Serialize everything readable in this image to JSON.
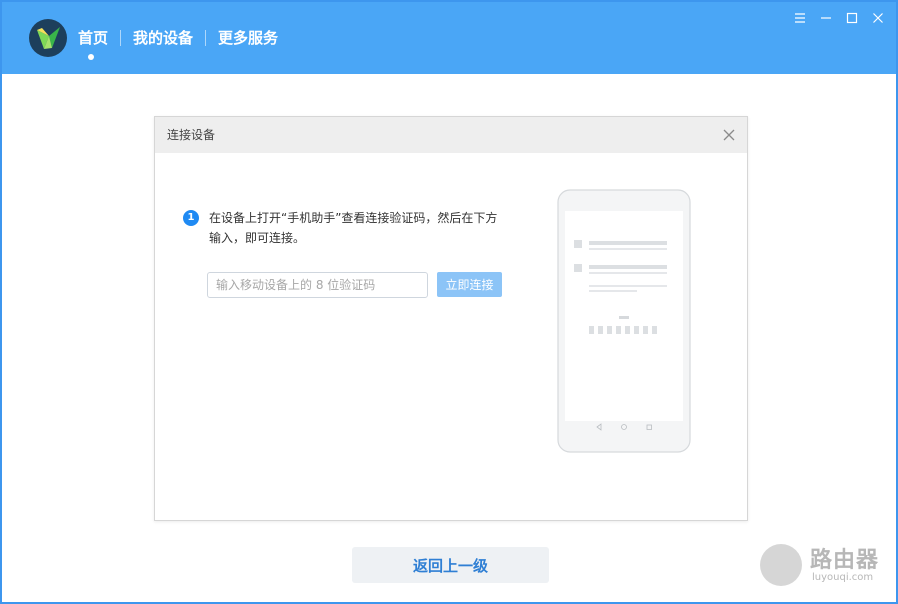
{
  "nav": {
    "items": [
      {
        "label": "首页",
        "active": true
      },
      {
        "label": "我的设备",
        "active": false
      },
      {
        "label": "更多服务",
        "active": false
      }
    ]
  },
  "window_controls": [
    "menu-icon",
    "minimize-icon",
    "maximize-icon",
    "close-icon"
  ],
  "dialog": {
    "title": "连接设备",
    "step_number": "1",
    "step_text": "在设备上打开“手机助手”查看连接验证码，然后在下方输入，即可连接。",
    "input_value": "",
    "input_placeholder": "输入移动设备上的 8 位验证码",
    "connect_label": "立即连接"
  },
  "back_label": "返回上一级",
  "watermark": {
    "text": "路由器",
    "sub": "luyouqi.com"
  },
  "colors": {
    "titlebar": "#4aa6f6",
    "accent": "#1f8af3",
    "connect_disabled": "#8cc4f7",
    "back_text": "#2f7fd4"
  }
}
